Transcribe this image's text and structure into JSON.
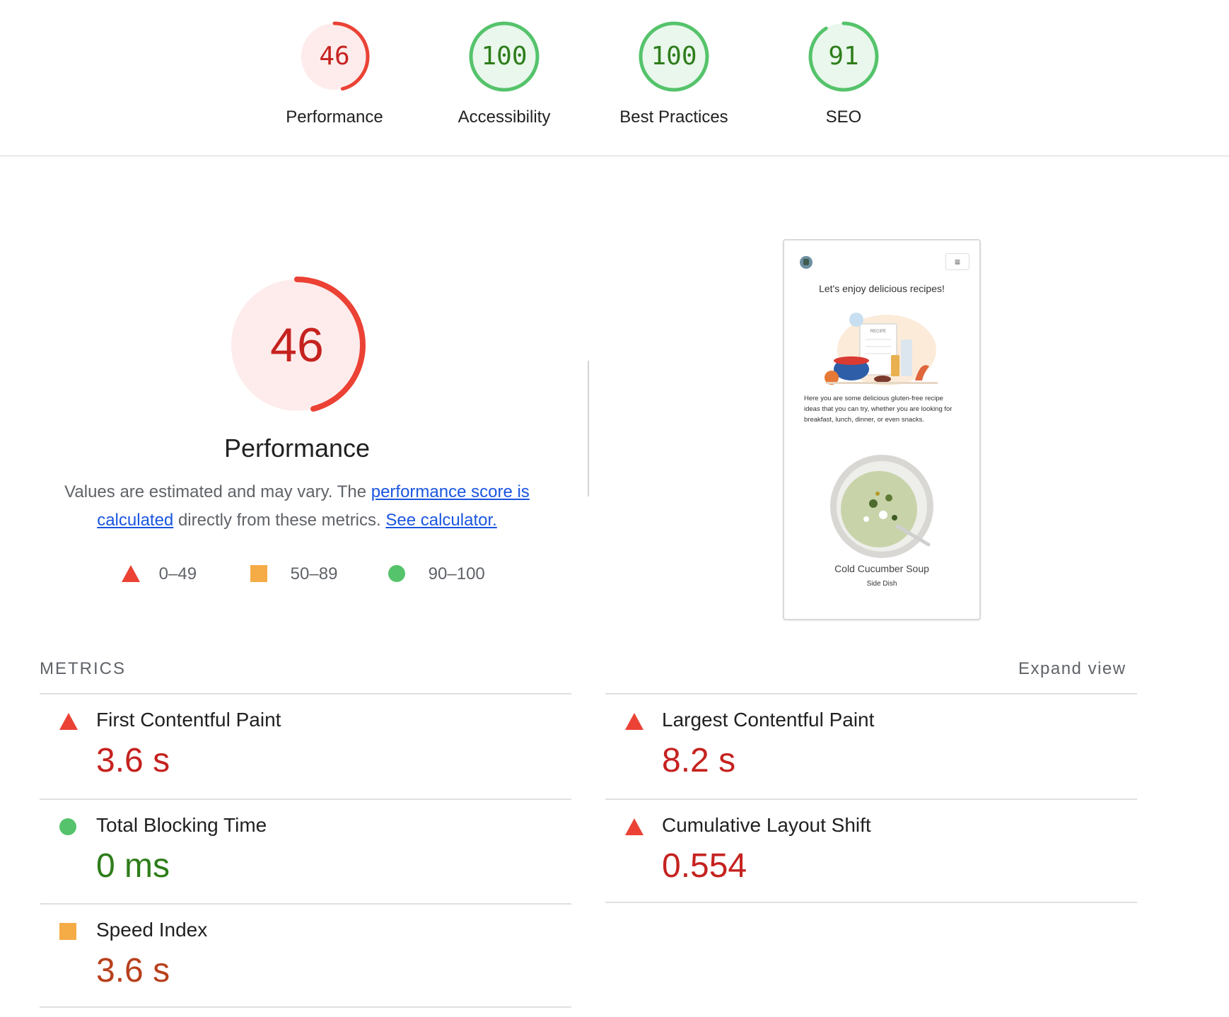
{
  "colors": {
    "fail": "#eb4235",
    "fail_text": "#c5221f",
    "average": "#f5ab46",
    "pass": "#55c36b",
    "pass_text": "#2e7d1a",
    "link": "#1a55e0"
  },
  "categories": [
    {
      "score": "46",
      "label": "Performance",
      "rating": "fail",
      "fraction": 0.46
    },
    {
      "score": "100",
      "label": "Accessibility",
      "rating": "pass",
      "fraction": 1.0
    },
    {
      "score": "100",
      "label": "Best Practices",
      "rating": "pass",
      "fraction": 1.0
    },
    {
      "score": "91",
      "label": "SEO",
      "rating": "pass",
      "fraction": 0.91
    }
  ],
  "performance": {
    "score": "46",
    "fraction": 0.46,
    "title": "Performance",
    "desc_prefix": "Values are estimated and may vary. The ",
    "desc_link1": "performance score is calculated",
    "desc_middle": " directly from these metrics. ",
    "desc_link2": "See calculator."
  },
  "legend": [
    {
      "shape": "triangle",
      "range": "0–49"
    },
    {
      "shape": "square",
      "range": "50–89"
    },
    {
      "shape": "circle",
      "range": "90–100"
    }
  ],
  "screenshot": {
    "menu_icon": "hamburger-icon",
    "headline": "Let's enjoy delicious recipes!",
    "illustration_text": "RECIPE",
    "intro": "Here you are some delicious gluten-free recipe ideas that you can try, whether you are looking for breakfast, lunch, dinner, or even snacks.",
    "recipe_title": "Cold Cucumber Soup",
    "recipe_category": "Side Dish"
  },
  "metrics": {
    "heading": "METRICS",
    "expand": "Expand view",
    "items": [
      {
        "label": "First Contentful Paint",
        "value": "3.6 s",
        "rating": "fail"
      },
      {
        "label": "Largest Contentful Paint",
        "value": "8.2 s",
        "rating": "fail"
      },
      {
        "label": "Total Blocking Time",
        "value": "0 ms",
        "rating": "pass"
      },
      {
        "label": "Cumulative Layout Shift",
        "value": "0.554",
        "rating": "fail"
      },
      {
        "label": "Speed Index",
        "value": "3.6 s",
        "rating": "average"
      }
    ]
  }
}
